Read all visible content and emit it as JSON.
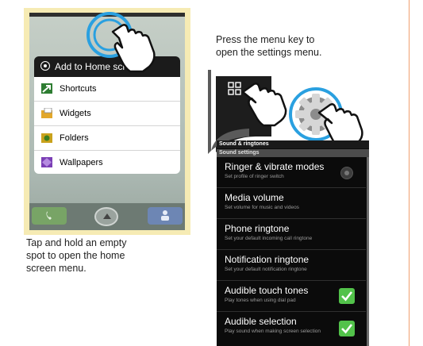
{
  "left_menu": {
    "header": "Add to Home screen",
    "items": [
      {
        "label": "Shortcuts",
        "icon": "shortcut-arrow-icon"
      },
      {
        "label": "Widgets",
        "icon": "widgets-folder-icon"
      },
      {
        "label": "Folders",
        "icon": "folder-icon"
      },
      {
        "label": "Wallpapers",
        "icon": "wallpaper-icon"
      }
    ]
  },
  "left_caption": [
    "Tap and hold an empty",
    "spot to open the home",
    "screen menu."
  ],
  "right_caption": [
    "Press the menu key to",
    "open the settings menu."
  ],
  "settings": {
    "title": "Sound & ringtones",
    "section": "Sound settings",
    "rows": [
      {
        "title": "Ringer & vibrate modes",
        "subtitle": "Set profile of ringer switch",
        "control": "radio"
      },
      {
        "title": "Media volume",
        "subtitle": "Set volume for music and videos",
        "control": "none"
      },
      {
        "title": "Phone ringtone",
        "subtitle": "Set your default incoming call ringtone",
        "control": "none"
      },
      {
        "title": "Notification ringtone",
        "subtitle": "Set your default notification ringtone",
        "control": "none"
      },
      {
        "title": "Audible touch tones",
        "subtitle": "Play tones when using dial pad",
        "control": "checked"
      },
      {
        "title": "Audible selection",
        "subtitle": "Play sound when making screen selection",
        "control": "checked"
      }
    ]
  },
  "colors": {
    "panel_bg": "#f6ebb4",
    "accent_ring": "#2aa0e0",
    "check_green": "#52c24a",
    "right_rule": "#f0a070"
  }
}
